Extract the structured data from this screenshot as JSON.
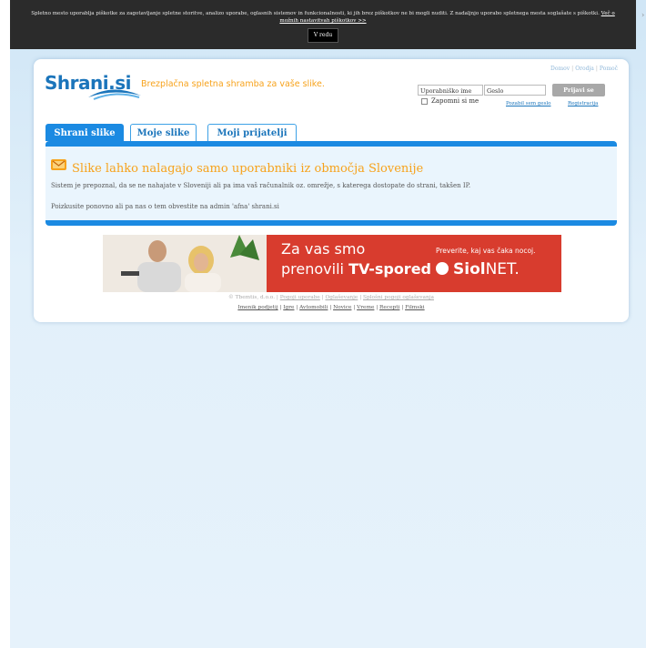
{
  "cookie": {
    "text": "Spletno mesto uporablja piškotke za zagotavljanje spletne storitve, analizo uporabe, oglasnih sistemov in funkcionalnosti, ki jih brez piškotkov ne bi mogli nuditi. Z nadaljnjo uporabo spletnega mesta soglašate s piškotki.",
    "link": "Več o možnih nastavitvah piškotkov >>",
    "ok_label": "V redu"
  },
  "header": {
    "logo": "Shrani.si",
    "tagline": "Brezplačna spletna shramba za vaše slike.",
    "links": [
      "Domov",
      "Orodja",
      "Pomoč"
    ]
  },
  "login": {
    "username_value": "Uporabniško ime",
    "password_value": "Geslo",
    "submit_label": "Prijavi se",
    "remember_label": "Zapomni si me",
    "forgot_label": "Pozabil sem geslo",
    "register_label": "Registracija"
  },
  "tabs": [
    {
      "label": "Shrani slike"
    },
    {
      "label": "Moje slike"
    },
    {
      "label": "Moji prijatelji"
    }
  ],
  "message": {
    "title": "Slike lahko nalagajo samo uporabniki iz območja Slovenije",
    "line1": "Sistem je prepoznal, da se ne nahajate v Sloveniji ali pa ima vaš računalnik oz. omrežje, s katerega dostopate do strani, takšen IP.",
    "line2": "Poizkusite ponovno ali pa nas o tem obvestite na admin 'afna' shrani.si"
  },
  "ad": {
    "headline1": "Za vas smo",
    "headline2_prefix": "prenovili",
    "headline2_bold": "TV-spored",
    "cta": "Preverite, kaj vas čaka nocoj.",
    "brand_bold": "Siol",
    "brand_rest": "NET."
  },
  "footer": {
    "copyright": "© Tbemtis, d.o.o.",
    "links1": [
      "Pogoji uporabe",
      "Oglaševanje",
      "Splošni pogoji oglaševanja"
    ],
    "links2": [
      "Imenik podjetij",
      "Igre",
      "Avtomobili",
      "Novice",
      "Vreme",
      "Recepti",
      "Filmski"
    ]
  },
  "colors": {
    "accent_blue": "#1b8ae2",
    "accent_orange": "#f7a21b",
    "ad_red": "#d83c2e"
  }
}
